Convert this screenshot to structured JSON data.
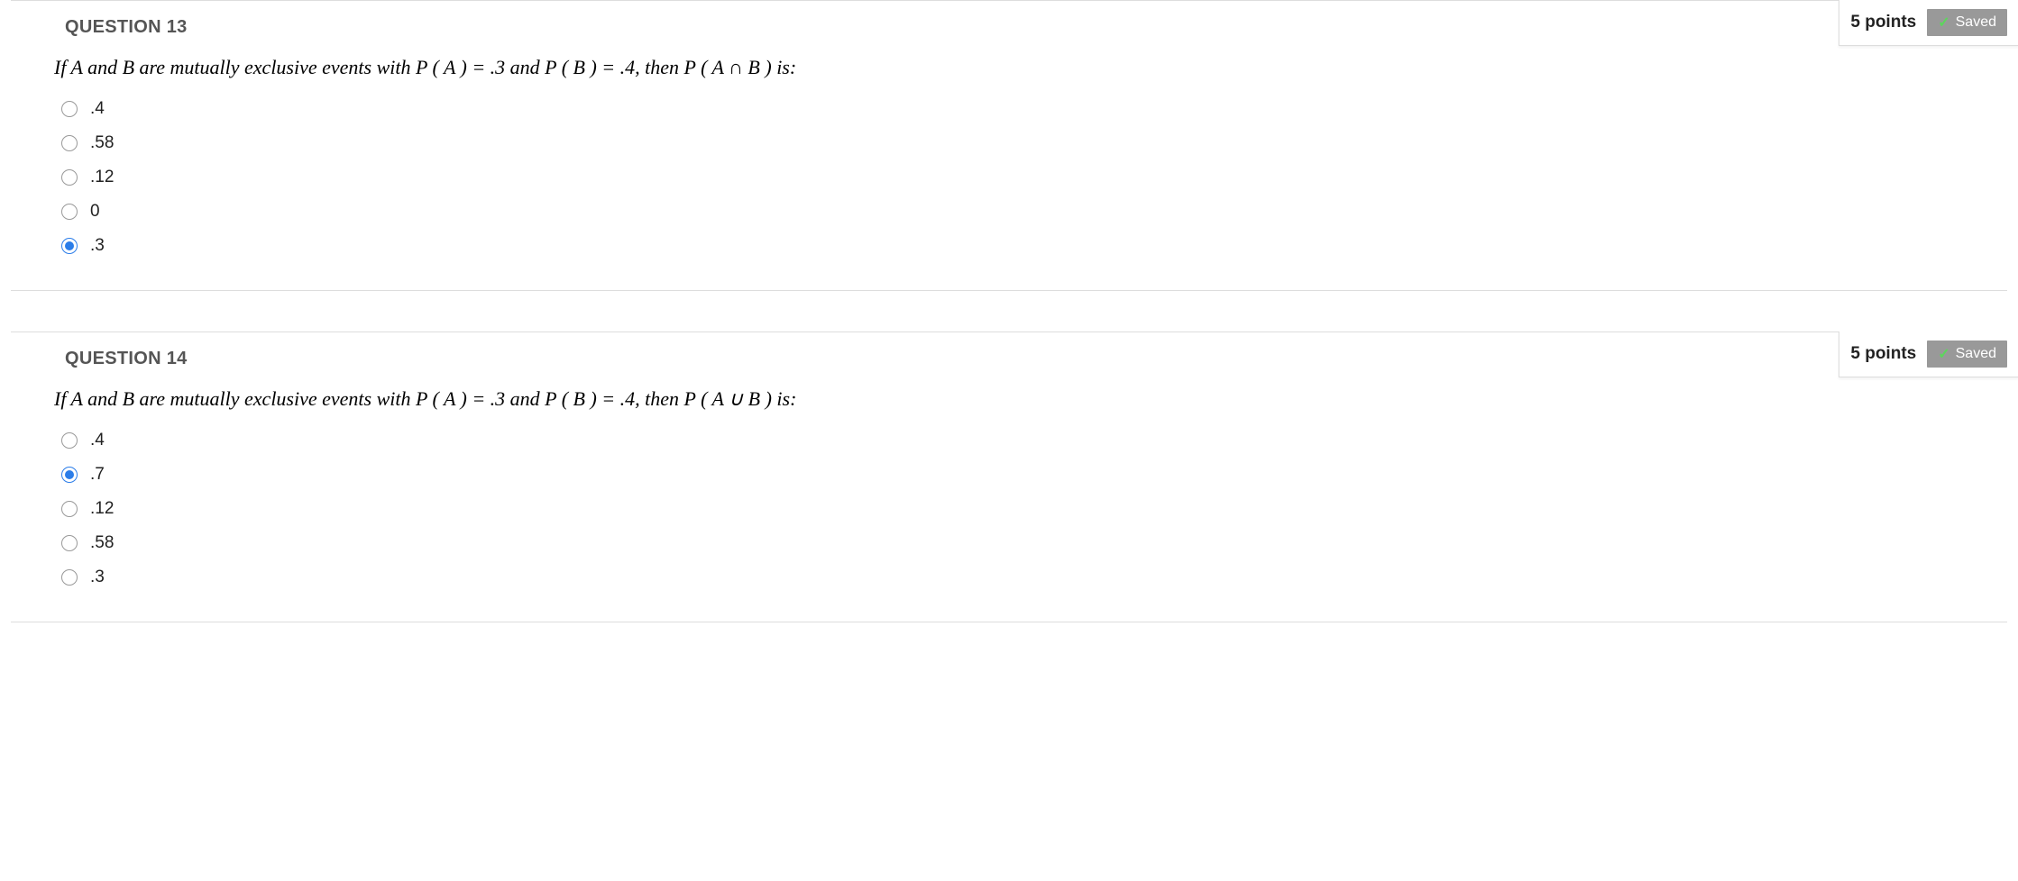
{
  "questions": [
    {
      "title": "QUESTION 13",
      "points": "5 points",
      "saved_label": "Saved",
      "prompt_prefix": "If A and B are mutually exclusive events with  P ( A ) = .3 and P ( B ) = .4, then P ( A ∩ B )  is:",
      "options": [
        {
          "label": ".4",
          "selected": false
        },
        {
          "label": ".58",
          "selected": false
        },
        {
          "label": ".12",
          "selected": false
        },
        {
          "label": "0",
          "selected": false
        },
        {
          "label": ".3",
          "selected": true
        }
      ]
    },
    {
      "title": "QUESTION 14",
      "points": "5 points",
      "saved_label": "Saved",
      "prompt_prefix": "If A and B are mutually exclusive events with  P ( A ) = .3 and P ( B ) = .4, then P ( A ∪ B )  is:",
      "options": [
        {
          "label": ".4",
          "selected": false
        },
        {
          "label": ".7",
          "selected": true
        },
        {
          "label": ".12",
          "selected": false
        },
        {
          "label": ".58",
          "selected": false
        },
        {
          "label": ".3",
          "selected": false
        }
      ]
    }
  ]
}
